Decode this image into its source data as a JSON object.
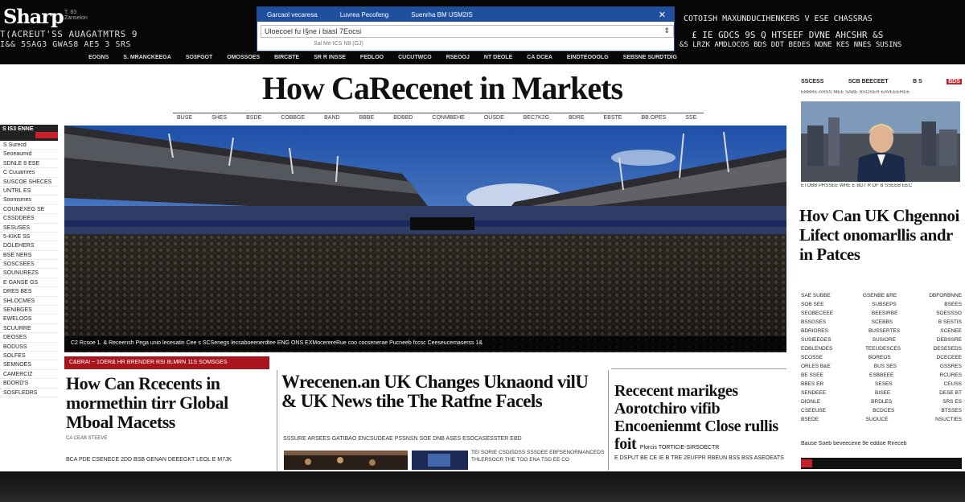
{
  "masthead": {
    "logo": "Sharp",
    "logo_tag": "T. 83 Zanselon",
    "left_line1": "T(ACREUT'SS AUAGATMTRS 9",
    "left_line2": "I&& 5SAG3 GWAS8 AE5 3 SRS"
  },
  "browser": {
    "tabs": [
      "Garcaol vecaresa",
      "Luvrea Pecofeng",
      "Suenrha BM USM2IS"
    ],
    "close": "✕",
    "url": "Uloecoel fu I§ne i biasl 7Eocsi",
    "dropdown": "⇕",
    "sub": "Sal   Me   ICS   N9 (GJ)"
  },
  "topright": {
    "line1": "COTOISH MAXUNDUCIHENKERS   V  ESE CHASSRAS",
    "line2": "£ IE  GDCS 9S     Q HTSEEF    DVNE AHCSHR &S",
    "line3": "&S LRZK AMDLOCOS BDS    DDT BEDES   NDNE KES  NNES SUSINS"
  },
  "navstrip": [
    "EOGNS",
    "S. MRANCKEEGA",
    "SO3FGOT",
    "OMOSSOES",
    "BIRCBTE",
    "SR R INSSE",
    "FEDLOO",
    "CUCUTWCO",
    "RSEOOJ",
    "NT DEOLE",
    "CA DCEA",
    "EINDTEOOOLG",
    "SEBSNE SURDTDIG"
  ],
  "headline": "How CaRecenet in Markets",
  "subnav": [
    "BUSE",
    "SHES",
    "BSDE",
    "COBBGE",
    "BAND",
    "BBBE",
    "BDBBD",
    "CONMBEHE",
    "OUSDE",
    "BEC7K2G",
    "BDRE",
    "EBSTE",
    "BB.OPES",
    "SSE"
  ],
  "sidebar": {
    "tag": "S IS3 ENNE",
    "items": [
      "S Surecd",
      "Seoeaumid",
      "SDNLE 8 ESE",
      "C Cuuamres",
      "SUSCOE SHECES",
      "UNTRL ES",
      "Soomsmes",
      "COUNEXEG SE",
      "CSSDDEES",
      "SESUSES",
      "5-KIKE SS",
      "DOLEHERS",
      "BSE NERS",
      "SOSCSEES",
      "SOUNUREZS",
      "E GANSE GS",
      "DRES BES",
      "SHLOCMES",
      "SENIBGES",
      "EWELOOS",
      "SCUURRE",
      "DEOSES",
      "BODUSS",
      "SOLFES",
      "SEMNOES",
      "CAMERCIZ",
      "BDORD'S",
      "SOSFLEDRS"
    ]
  },
  "hero": {
    "caption": "C2 Rcsoe 1.  &  Receensh Pega  unio  lecesatin  Cee s  SCSenegs  lecsaboeenerdtee  ENG  ONS  EXMocerereRue  coo  cocsenerae  Pucneeb  fccsc  Ceeseucemaserss  1&"
  },
  "story1": {
    "tag": "C&BRAI  ~ 1OER&   HR BRENDER  RSI 8LMRN 11S  SOMSGES",
    "headline": "How Can Rcecents in mormethin tirr Global Mboal Macetss",
    "meta": "CA CEAB   STEEVE",
    "byline": "BCA PDE CSENECE 2DD BSB GENAN DEEEGKT LEOL E M7JK"
  },
  "story2": {
    "headline": "Wrecenen.an UK Changes Uknaond vilU & UK News tihe The Ratfne Facels",
    "meta": "SSSURE ARSEES  GATIBAO ENCSUDEAE PSSNSN SOE DNB ASES  ESOCASESSTER EBD",
    "side": "TEI SORIE CSDISDSS SSSDEE  EBFSENORMANCEDS  THLERSOCR THE TOO ENA TSD EE CO"
  },
  "story3": {
    "headline": "Rececent marikges Aorotchiro vifib Encoenienmt Close rullis foit",
    "kicker": "Plorcis TORTICIE-SIRSOECTR",
    "byline": "E  DSPUT BE CE IE B   TRE 2EUFPR RBEUN BSS BSS ASEOEATS"
  },
  "rightcol": {
    "top_left": "SSCESS",
    "top_mid": "SCB   BEECEET",
    "top_right": "B  S",
    "badge": "BDS",
    "sub": "EBBRE-ARSS MEE SABE   BSOSER EAVEEEREE",
    "caption": "ETOBB  PRSSEE  WRE E BDT  R DF B SSEEB EEC",
    "headline": "Hov Can UK Chgennoi Lifect onomarllis andr in Patces",
    "brief": [
      [
        "SAE SUBBE",
        "GSENBE &RE",
        "DBFORBNNE"
      ],
      [
        "SOB SEE",
        "SUBSEPS",
        "BSEES"
      ],
      [
        "SEOBECEEE",
        "BEESIRBE",
        "SOESSSO"
      ],
      [
        "BSSGSES",
        "SCEBBS",
        "B SESTIS"
      ],
      [
        "BDRIORES",
        "BUSSERTES",
        "SCENEE"
      ],
      [
        "SUSIEEGES",
        "SUSIORE",
        "DEBSSRE"
      ],
      [
        "EDBLENDES",
        "TEEUDESCES",
        "DESESEDS"
      ],
      [
        "SCOSSE",
        "BOREOS",
        "DCECEEE"
      ],
      [
        "ORLES B&E",
        "BUS SES",
        "GSSRES"
      ],
      [
        "BE SSEE",
        "ESBBEEE",
        "RCURES"
      ],
      [
        "BBES ER",
        "SESES",
        "CEUSS"
      ],
      [
        "SENDEEE",
        "BISEE",
        "DESE BT"
      ],
      [
        "DIONLE",
        "BRDLES",
        "SRS ES"
      ],
      [
        "CSEEUSE",
        "BCDCES",
        "BTSSES"
      ],
      [
        "BSEDE",
        "SUOUCE",
        "NSUCTIES"
      ]
    ],
    "footer": "Bause Soeb beveecene 9e eddoe Rireceb"
  },
  "colors": {
    "accent_red": "#c8202a",
    "masthead_bg": "#070707",
    "browser_blue": "#1f4f9f"
  }
}
